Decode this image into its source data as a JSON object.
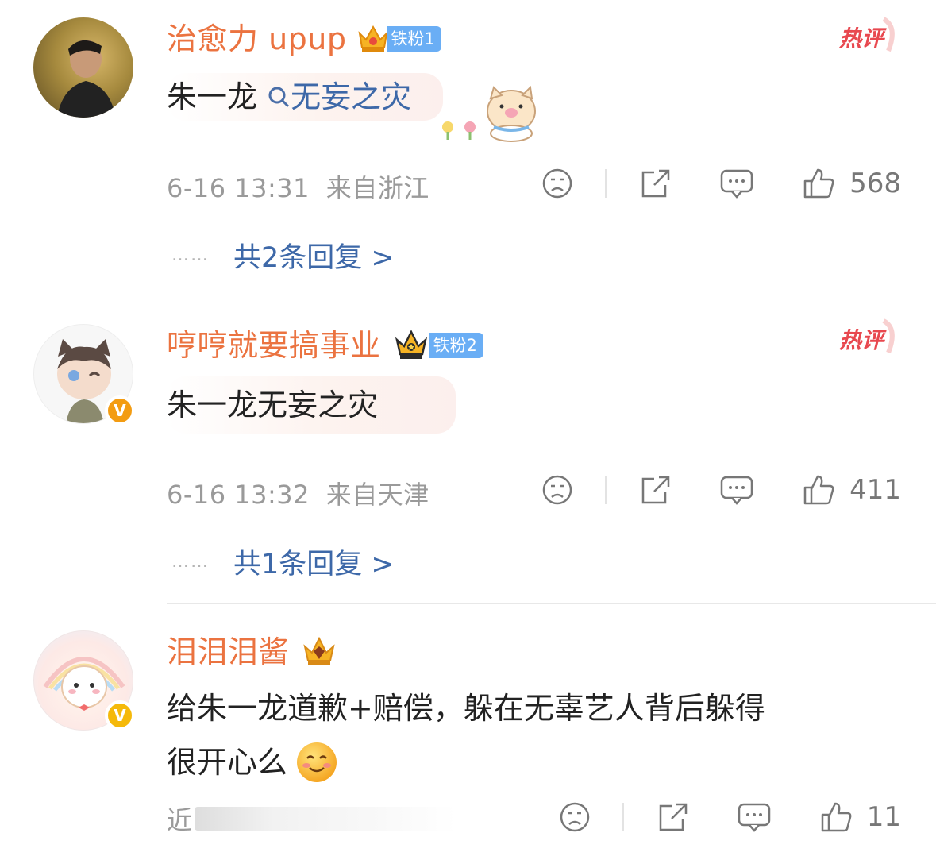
{
  "comments": [
    {
      "username": "治愈力 upup",
      "fan_badge": "铁粉1",
      "hot_label": "热评",
      "content_prefix": "朱一龙",
      "content_link": "无妄之灾",
      "timestamp": "6-16 13:31",
      "location": "来自浙江",
      "likes": "568",
      "replies_label": "共2条回复 >"
    },
    {
      "username": "哼哼就要搞事业",
      "fan_badge": "铁粉2",
      "hot_label": "热评",
      "content": "朱一龙无妄之灾",
      "timestamp": "6-16 13:32",
      "location": "来自天津",
      "likes": "411",
      "replies_label": "共1条回复 >"
    },
    {
      "username": "泪泪泪酱",
      "content_line1": "给朱一龙道歉+赔偿，躲在无辜艺人背后躲得",
      "content_line2": "很开心么",
      "timestamp_prefix": "近",
      "likes": "11"
    }
  ],
  "dots": "……",
  "verified_mark": "V",
  "colors": {
    "username": "#eb7340",
    "link": "#3d68a8",
    "meta": "#9a9a9a",
    "fan_badge": "#6aaef5",
    "hot": "#e8484f"
  }
}
